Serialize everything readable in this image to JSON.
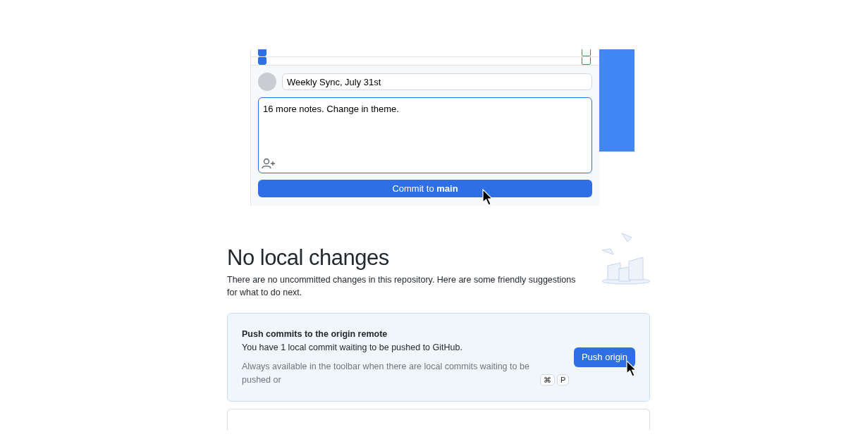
{
  "file_rows": [
    {
      "checked": true
    },
    {
      "checked": true
    }
  ],
  "commit": {
    "summary": "Weekly Sync, July 31st",
    "description": "16 more notes. Change in theme.",
    "button": "Commit to **main**"
  },
  "empty_state": {
    "title": "No local changes",
    "text": "There are no uncommitted changes in this repository. Here are some friendly suggestions for what to do next."
  },
  "push_card": {
    "title": "Push commits to the origin remote",
    "text": "You have 1 local commit waiting to be pushed to GitHub.",
    "hint": "Always available in the toolbar when there are local commits waiting to be pushed or",
    "keys": [
      "⌘",
      "P"
    ],
    "button": "Push origin"
  }
}
